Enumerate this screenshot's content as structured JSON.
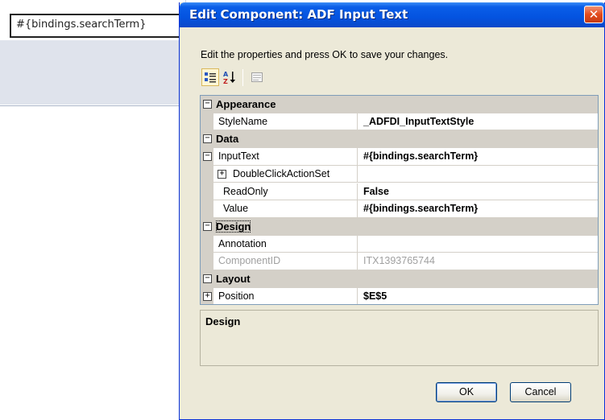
{
  "background": {
    "cell_value": "#{bindings.searchTerm}"
  },
  "dialog": {
    "title": "Edit Component: ADF Input Text",
    "close_glyph": "✕",
    "instructions": "Edit the properties and press OK to save your changes.",
    "toolbar": {
      "categorized_icon": "categorized-icon",
      "alphabetical_icon": "sort-alphabetical-icon",
      "property_pages_icon": "property-pages-icon"
    },
    "grid": {
      "rows": [
        {
          "type": "category",
          "label": "Appearance",
          "expander": "⊟"
        },
        {
          "type": "prop",
          "label": "StyleName",
          "value": "_ADFDI_InputTextStyle"
        },
        {
          "type": "category",
          "label": "Data",
          "expander": "⊟"
        },
        {
          "type": "prop",
          "label": "InputText",
          "value": "#{bindings.searchTerm}",
          "expander": "−"
        },
        {
          "type": "prop",
          "label": "DoubleClickActionSet",
          "value": "",
          "expander": "+"
        },
        {
          "type": "prop",
          "label": "ReadOnly",
          "value": "False"
        },
        {
          "type": "prop",
          "label": "Value",
          "value": "#{bindings.searchTerm}"
        },
        {
          "type": "category",
          "label": "Design",
          "expander": "⊟"
        },
        {
          "type": "prop",
          "label": "Annotation",
          "value": ""
        },
        {
          "type": "prop",
          "label": "ComponentID",
          "value": "ITX1393765744",
          "disabled": true
        },
        {
          "type": "category",
          "label": "Layout",
          "expander": "⊟"
        },
        {
          "type": "prop",
          "label": "Position",
          "value": "$E$5",
          "expander": "+"
        }
      ]
    },
    "description": {
      "title": "Design"
    },
    "buttons": {
      "ok": "OK",
      "cancel": "Cancel"
    }
  }
}
